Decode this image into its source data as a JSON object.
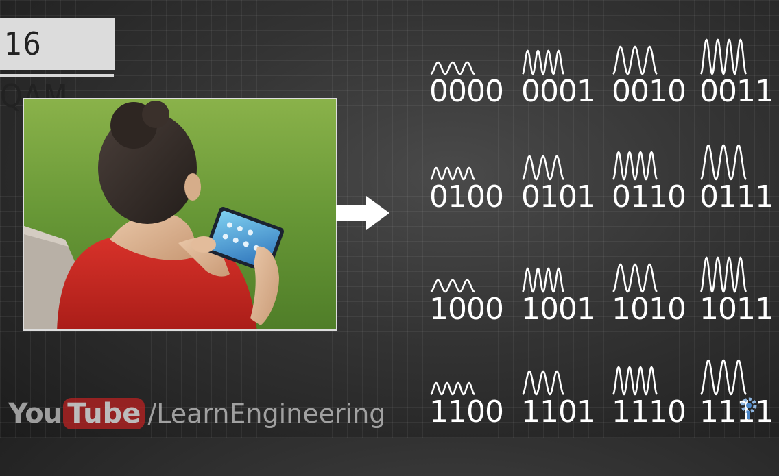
{
  "title": "16 QAM",
  "watermark": {
    "you": "You",
    "tube": "Tube",
    "channel": "/LearnEngineering"
  },
  "symbols": [
    {
      "code": "0000",
      "row": 0,
      "col": 0
    },
    {
      "code": "0001",
      "row": 0,
      "col": 1
    },
    {
      "code": "0010",
      "row": 0,
      "col": 2
    },
    {
      "code": "0011",
      "row": 0,
      "col": 3
    },
    {
      "code": "0100",
      "row": 1,
      "col": 0
    },
    {
      "code": "0101",
      "row": 1,
      "col": 1
    },
    {
      "code": "0110",
      "row": 1,
      "col": 2
    },
    {
      "code": "0111",
      "row": 1,
      "col": 3
    },
    {
      "code": "1000",
      "row": 2,
      "col": 0
    },
    {
      "code": "1001",
      "row": 2,
      "col": 1
    },
    {
      "code": "1010",
      "row": 2,
      "col": 2
    },
    {
      "code": "1011",
      "row": 2,
      "col": 3
    },
    {
      "code": "1100",
      "row": 3,
      "col": 0
    },
    {
      "code": "1101",
      "row": 3,
      "col": 1
    },
    {
      "code": "1110",
      "row": 3,
      "col": 2
    },
    {
      "code": "1111",
      "row": 3,
      "col": 3
    }
  ],
  "amplitude_levels": [
    "small",
    "medium",
    "large",
    "extra-large"
  ],
  "colors": {
    "wave": "#ffffff",
    "badge_bg": "#dcdcdc",
    "shirt": "#c8241f"
  }
}
